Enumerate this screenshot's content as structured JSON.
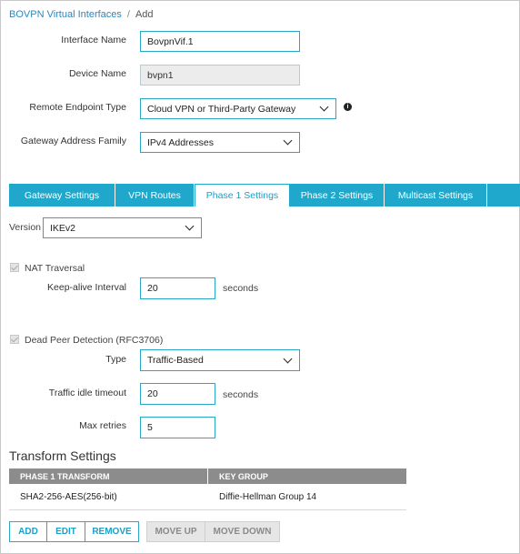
{
  "breadcrumb": {
    "parent": "BOVPN Virtual Interfaces",
    "separator": "/",
    "current": "Add"
  },
  "form": {
    "interface_name": {
      "label": "Interface Name",
      "value": "BovpnVif.1"
    },
    "device_name": {
      "label": "Device Name",
      "value": "bvpn1"
    },
    "remote_endpoint_type": {
      "label": "Remote Endpoint Type",
      "value": "Cloud VPN or Third-Party Gateway",
      "info_icon": "info-icon"
    },
    "gateway_address_family": {
      "label": "Gateway Address Family",
      "value": "IPv4 Addresses"
    }
  },
  "tabs": [
    {
      "label": "Gateway Settings",
      "active": false
    },
    {
      "label": "VPN Routes",
      "active": false
    },
    {
      "label": "Phase 1 Settings",
      "active": true
    },
    {
      "label": "Phase 2 Settings",
      "active": false
    },
    {
      "label": "Multicast Settings",
      "active": false
    }
  ],
  "phase1": {
    "version": {
      "label": "Version",
      "value": "IKEv2"
    },
    "nat_traversal": {
      "label": "NAT Traversal",
      "checked": true,
      "disabled": true
    },
    "keepalive": {
      "label": "Keep-alive Interval",
      "value": "20",
      "unit": "seconds"
    },
    "dpd": {
      "label": "Dead Peer Detection (RFC3706)",
      "checked": true,
      "disabled": true
    },
    "type": {
      "label": "Type",
      "value": "Traffic-Based"
    },
    "idle_timeout": {
      "label": "Traffic idle timeout",
      "value": "20",
      "unit": "seconds"
    },
    "max_retries": {
      "label": "Max retries",
      "value": "5"
    }
  },
  "transform": {
    "title": "Transform Settings",
    "columns": [
      "PHASE 1 TRANSFORM",
      "KEY GROUP"
    ],
    "rows": [
      [
        "SHA2-256-AES(256-bit)",
        "Diffie-Hellman Group 14"
      ]
    ]
  },
  "buttons": {
    "add": "ADD",
    "edit": "EDIT",
    "remove": "REMOVE",
    "move_up": "MOVE UP",
    "move_down": "MOVE DOWN"
  },
  "colors": {
    "accent": "#1fa8cc",
    "link": "#2a88c0",
    "table_header": "#8c8c8c"
  }
}
